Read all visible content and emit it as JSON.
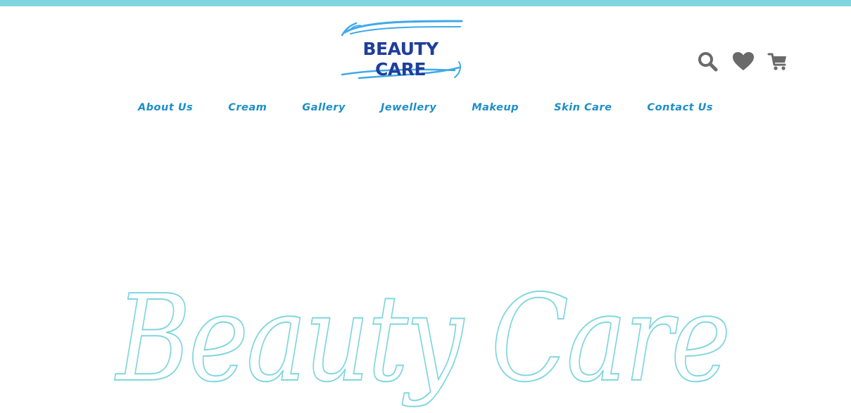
{
  "brand": {
    "logo_text": "BEAUTY CARE",
    "hero_text": "Beauty Care",
    "accent_color": "#7fd6df",
    "logo_text_color": "#1f3e9b",
    "logo_wave_color": "#3fa9e8",
    "nav_color": "#1d8ec8",
    "icon_color": "#6a6a6a"
  },
  "header": {
    "icons": [
      "search-icon",
      "heart-icon",
      "cart-icon"
    ]
  },
  "nav": {
    "items": [
      "About Us",
      "Cream",
      "Gallery",
      "Jewellery",
      "Makeup",
      "Skin Care",
      "Contact Us"
    ]
  }
}
